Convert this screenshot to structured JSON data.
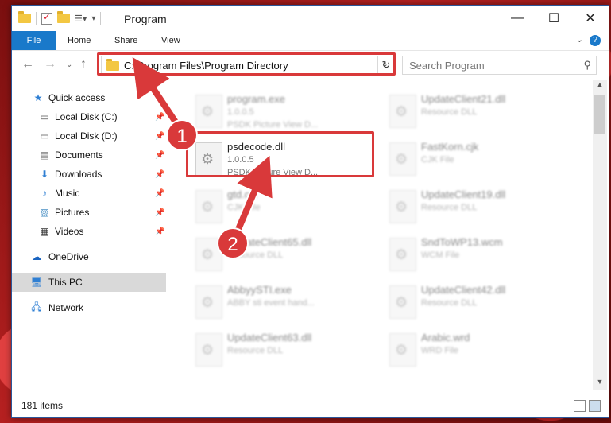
{
  "window": {
    "title": "Program",
    "controls": {
      "minimize": "—",
      "maximize": "☐",
      "close": "✕"
    }
  },
  "ribbon": {
    "tabs": [
      "File",
      "Home",
      "Share",
      "View"
    ],
    "help": "?"
  },
  "nav": {
    "address": "C:\\Program Files\\Program Directory",
    "search_placeholder": "Search Program"
  },
  "sidebar": {
    "items": [
      {
        "label": "Quick access",
        "icon": "star-icon"
      },
      {
        "label": "Local Disk (C:)",
        "icon": "drive-icon",
        "pinned": true
      },
      {
        "label": "Local Disk (D:)",
        "icon": "drive-icon",
        "pinned": true
      },
      {
        "label": "Documents",
        "icon": "documents-icon",
        "pinned": true
      },
      {
        "label": "Downloads",
        "icon": "download-icon",
        "pinned": true
      },
      {
        "label": "Music",
        "icon": "music-icon",
        "pinned": true
      },
      {
        "label": "Pictures",
        "icon": "pictures-icon",
        "pinned": true
      },
      {
        "label": "Videos",
        "icon": "videos-icon",
        "pinned": true
      },
      {
        "label": "OneDrive",
        "icon": "cloud-icon"
      },
      {
        "label": "This PC",
        "icon": "computer-icon",
        "selected": true
      },
      {
        "label": "Network",
        "icon": "network-icon"
      }
    ]
  },
  "files": [
    {
      "name": "program.exe",
      "line1": "1.0.0.5",
      "line2": "PSDK Picture View D...",
      "blurred": true
    },
    {
      "name": "UpdateClient21.dll",
      "line1": "Resource DLL",
      "line2": "",
      "blurred": true
    },
    {
      "name": "psdecode.dll",
      "line1": "1.0.0.5",
      "line2": "PSDK Picture View D...",
      "blurred": false
    },
    {
      "name": "FastKorn.cjk",
      "line1": "CJK File",
      "line2": "",
      "blurred": true
    },
    {
      "name": "gtd.cjk",
      "line1": "CJK File",
      "line2": "",
      "blurred": true
    },
    {
      "name": "UpdateClient19.dll",
      "line1": "Resource DLL",
      "line2": "",
      "blurred": true
    },
    {
      "name": "UpdateClient65.dll",
      "line1": "Resource DLL",
      "line2": "",
      "blurred": true
    },
    {
      "name": "SndToWP13.wcm",
      "line1": "WCM File",
      "line2": "",
      "blurred": true
    },
    {
      "name": "AbbyySTI.exe",
      "line1": "ABBY sti event hand...",
      "line2": "",
      "blurred": true
    },
    {
      "name": "UpdateClient42.dll",
      "line1": "Resource DLL",
      "line2": "",
      "blurred": true
    },
    {
      "name": "UpdateClient63.dll",
      "line1": "Resource DLL",
      "line2": "",
      "blurred": true
    },
    {
      "name": "Arabic.wrd",
      "line1": "WRD File",
      "line2": "",
      "blurred": true
    }
  ],
  "status": {
    "items": "181 items"
  },
  "callouts": [
    "1",
    "2"
  ],
  "colors": {
    "accent": "#1979ca",
    "highlight": "#d9393a"
  }
}
